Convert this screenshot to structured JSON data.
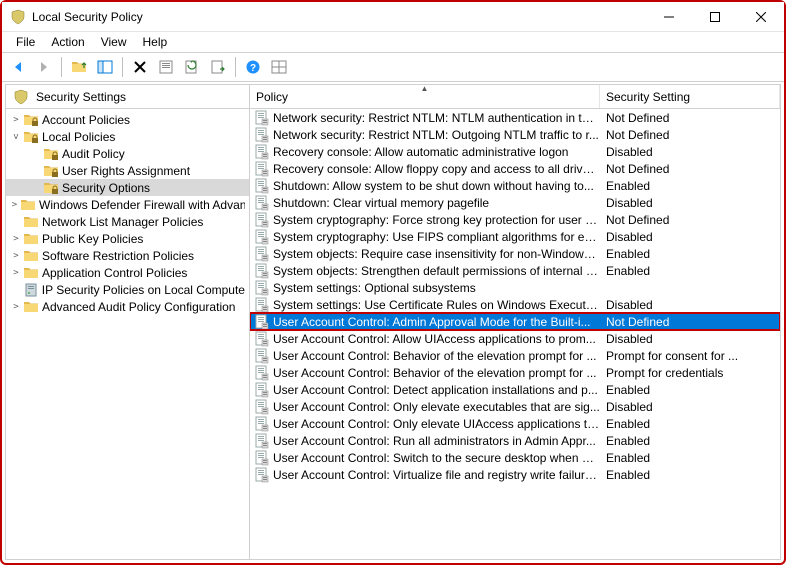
{
  "window": {
    "title": "Local Security Policy"
  },
  "menu": {
    "file": "File",
    "action": "Action",
    "view": "View",
    "help": "Help"
  },
  "tree": {
    "root": "Security Settings",
    "account_policies": "Account Policies",
    "local_policies": "Local Policies",
    "audit_policy": "Audit Policy",
    "user_rights": "User Rights Assignment",
    "security_options": "Security Options",
    "defender": "Windows Defender Firewall with Advanced Security",
    "netlist": "Network List Manager Policies",
    "pubkey": "Public Key Policies",
    "softrestrict": "Software Restriction Policies",
    "appctrl": "Application Control Policies",
    "ipsec": "IP Security Policies on Local Computer",
    "advaudit": "Advanced Audit Policy Configuration"
  },
  "columns": {
    "policy": "Policy",
    "setting": "Security Setting"
  },
  "policies": [
    {
      "name": "Network security: Restrict NTLM: NTLM authentication in thi...",
      "setting": "Not Defined"
    },
    {
      "name": "Network security: Restrict NTLM: Outgoing NTLM traffic to r...",
      "setting": "Not Defined"
    },
    {
      "name": "Recovery console: Allow automatic administrative logon",
      "setting": "Disabled"
    },
    {
      "name": "Recovery console: Allow floppy copy and access to all drives...",
      "setting": "Not Defined"
    },
    {
      "name": "Shutdown: Allow system to be shut down without having to...",
      "setting": "Enabled"
    },
    {
      "name": "Shutdown: Clear virtual memory pagefile",
      "setting": "Disabled"
    },
    {
      "name": "System cryptography: Force strong key protection for user k...",
      "setting": "Not Defined"
    },
    {
      "name": "System cryptography: Use FIPS compliant algorithms for en...",
      "setting": "Disabled"
    },
    {
      "name": "System objects: Require case insensitivity for non-Windows ...",
      "setting": "Enabled"
    },
    {
      "name": "System objects: Strengthen default permissions of internal s...",
      "setting": "Enabled"
    },
    {
      "name": "System settings: Optional subsystems",
      "setting": ""
    },
    {
      "name": "System settings: Use Certificate Rules on Windows Executab...",
      "setting": "Disabled"
    },
    {
      "name": "User Account Control: Admin Approval Mode for the Built-i...",
      "setting": "Not Defined",
      "selected": true
    },
    {
      "name": "User Account Control: Allow UIAccess applications to prom...",
      "setting": "Disabled"
    },
    {
      "name": "User Account Control: Behavior of the elevation prompt for ...",
      "setting": "Prompt for consent for ..."
    },
    {
      "name": "User Account Control: Behavior of the elevation prompt for ...",
      "setting": "Prompt for credentials"
    },
    {
      "name": "User Account Control: Detect application installations and p...",
      "setting": "Enabled"
    },
    {
      "name": "User Account Control: Only elevate executables that are sig...",
      "setting": "Disabled"
    },
    {
      "name": "User Account Control: Only elevate UIAccess applications th...",
      "setting": "Enabled"
    },
    {
      "name": "User Account Control: Run all administrators in Admin Appr...",
      "setting": "Enabled"
    },
    {
      "name": "User Account Control: Switch to the secure desktop when pr...",
      "setting": "Enabled"
    },
    {
      "name": "User Account Control: Virtualize file and registry write failure...",
      "setting": "Enabled"
    }
  ]
}
